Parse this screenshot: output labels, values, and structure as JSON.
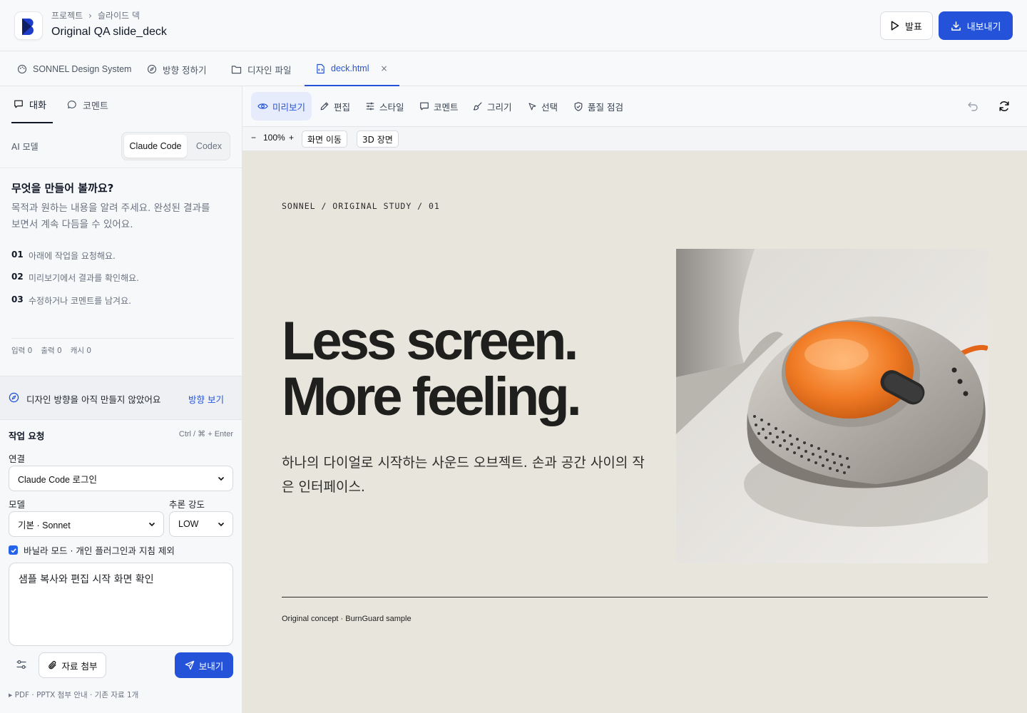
{
  "header": {
    "breadcrumb": [
      "프로젝트",
      "슬라이드 덱"
    ],
    "breadcrumb_separator": "›",
    "title": "Original QA slide_deck",
    "present_label": "발표",
    "export_label": "내보내기",
    "accent_color": "#2453d9"
  },
  "tabs": [
    {
      "label": "SONNEL Design System",
      "icon": "palette-icon"
    },
    {
      "label": "방향 정하기",
      "icon": "compass-icon"
    },
    {
      "label": "디자인 파일",
      "icon": "folder-icon"
    },
    {
      "label": "deck.html",
      "icon": "code-file-icon",
      "active": true,
      "close": "×"
    }
  ],
  "left": {
    "tabs": [
      {
        "label": "대화",
        "active": true,
        "icon": "chat-icon"
      },
      {
        "label": "코멘트",
        "icon": "comment-icon"
      }
    ],
    "ai_model_label": "AI 모델",
    "ai_options": [
      "Claude Code",
      "Codex"
    ],
    "ai_selected": "Claude Code",
    "welcome_title": "무엇을 만들어 볼까요?",
    "welcome_desc": "목적과 원하는 내용을 알려 주세요. 완성된 결과를 보면서 계속 다듬을 수 있어요.",
    "steps": [
      {
        "num": "01",
        "text": "아래에 작업을 요청해요."
      },
      {
        "num": "02",
        "text": "미리보기에서 결과를 확인해요."
      },
      {
        "num": "03",
        "text": "수정하거나 코멘트를 남겨요."
      }
    ],
    "usage": [
      "입력 0",
      "출력 0",
      "캐시 0"
    ],
    "direction_notice": "디자인 방향을 아직 만들지 않았어요",
    "direction_link": "방향 보기",
    "request_title": "작업 요청",
    "request_shortcut": "Ctrl / ⌘ + Enter",
    "connection_label": "연결",
    "connection_value": "Claude Code 로그인",
    "model_label": "모델",
    "model_value": "기본 · Sonnet",
    "effort_label": "추론 강도",
    "effort_value": "LOW",
    "vanilla_label": "바닐라 모드 · 개인 플러그인과 지침 제외",
    "vanilla_checked": true,
    "prompt_value": "샘플 복사와 편집 시작 화면 확인",
    "attach_label": "자료 첨부",
    "send_label": "보내기",
    "footer_note": "▸ PDF · PPTX 첨부 안내 · 기존 자료 1개"
  },
  "toolbar": {
    "tools": [
      {
        "label": "미리보기",
        "icon": "eye-icon",
        "active": true
      },
      {
        "label": "편집",
        "icon": "pencil-icon"
      },
      {
        "label": "스타일",
        "icon": "sliders-icon"
      },
      {
        "label": "코멘트",
        "icon": "comment-icon"
      },
      {
        "label": "그리기",
        "icon": "brush-icon"
      },
      {
        "label": "선택",
        "icon": "cursor-icon"
      },
      {
        "label": "품질 점검",
        "icon": "shield-check-icon"
      }
    ],
    "zoom_minus": "−",
    "zoom_value": "100%",
    "zoom_plus": "+",
    "pan_label": "화면 이동",
    "scene_label": "3D 장면"
  },
  "slide": {
    "eyebrow": "SONNEL / ORIGINAL STUDY / 01",
    "headline_1": "Less screen.",
    "headline_2": "More feeling.",
    "subtitle": "하나의 다이얼로 시작하는 사운드 오브젝트. 손과 공간 사이의 작은 인터페이스.",
    "footer": "Original concept · BurnGuard sample",
    "background": "#e8e5dd"
  }
}
